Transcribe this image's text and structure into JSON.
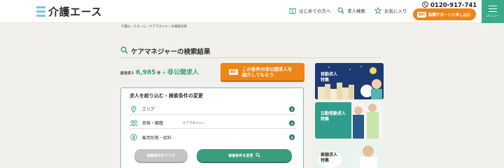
{
  "header": {
    "logo_text": "介護エース",
    "nav": [
      {
        "label": "はじめての方へ",
        "icon": "book-icon"
      },
      {
        "label": "求人検索",
        "icon": "search-icon"
      },
      {
        "label": "お気に入り",
        "icon": "star-icon"
      }
    ],
    "phone": "0120-917-741",
    "support": {
      "badge": "無料",
      "label": "転職サポートに申し込む"
    },
    "menu_label": "メニュー"
  },
  "breadcrumb": "介護エースホーム › ケアマネジャーの検索結果",
  "page_title": "ケアマネジャーの検索結果",
  "result": {
    "count_label": "該当求人",
    "count": "6,985",
    "unit": "件",
    "plus": "＋",
    "private_label": "非公開求人"
  },
  "intro_button": {
    "badge": "無料",
    "line1": "この条件の非公開求人を",
    "line2": "紹介してもらう"
  },
  "filter": {
    "title": "求人を絞り込む・検索条件の変更",
    "rows": [
      {
        "label": "エリア",
        "value": "",
        "icon": "pin-icon"
      },
      {
        "label": "資格・職種",
        "value": "ケアマネジャー",
        "icon": "people-icon"
      },
      {
        "label": "雇用形態・給料",
        "value": "",
        "icon": "yen-icon"
      }
    ],
    "clear_label": "検索条件をクリア",
    "change_label": "検索条件を変更"
  },
  "banners": [
    {
      "line1": "夜勤求人",
      "line2": "特集"
    },
    {
      "line1": "日勤常勤求人",
      "line2": "特集"
    },
    {
      "line1": "高額求人",
      "line2": "特集"
    }
  ],
  "colors": {
    "accent_green": "#3a9d7e",
    "accent_orange": "#ee8516",
    "menu_green": "#3aaa8a"
  }
}
